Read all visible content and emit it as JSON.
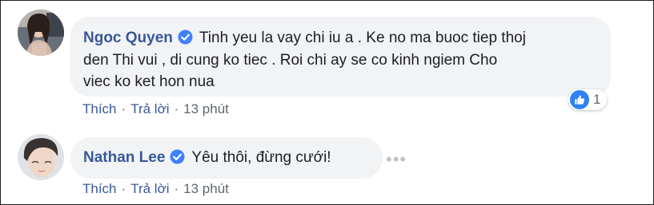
{
  "comments": [
    {
      "author": "Ngoc Quyen",
      "verified": true,
      "text_lines": [
        "Tinh yeu la vay chi iu a . Ke no ma buoc tiep thoj",
        "den Thi vui , di cung ko tiec . Roi chi ay se co kinh ngiem Cho",
        "viec ko ket hon nua"
      ],
      "actions": {
        "like": "Thích",
        "reply": "Trả lời",
        "separator": "·",
        "time": "13 phút"
      },
      "reaction": {
        "icon": "like-icon",
        "count": "1"
      }
    },
    {
      "author": "Nathan Lee",
      "verified": true,
      "text": "Yêu thôi, đừng cưới!",
      "actions": {
        "like": "Thích",
        "reply": "Trả lời",
        "separator": "·",
        "time": "13 phút"
      },
      "more": "•••"
    }
  ],
  "colors": {
    "author": "#385898",
    "bubble": "#f2f3f5",
    "meta": "#606770",
    "verified": "#4080ff",
    "like": "#2e81f4"
  }
}
